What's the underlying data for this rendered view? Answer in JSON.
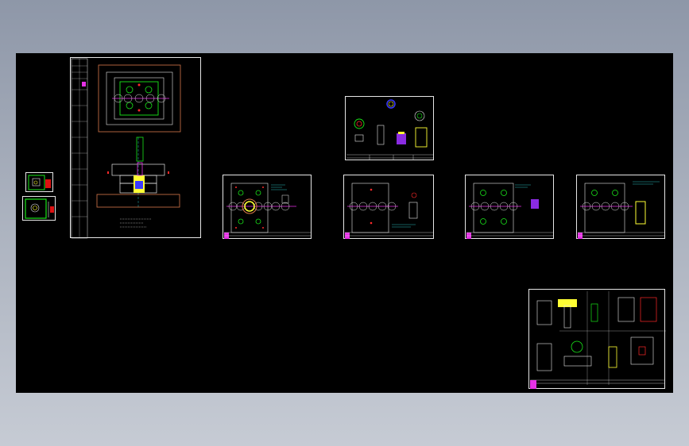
{
  "viewer": {
    "background_top": "#8e97a8",
    "background_bottom": "#c6cbd4",
    "canvas_color": "#000000"
  },
  "colors": {
    "frame": "#e6e6e6",
    "green": "#19e619",
    "red": "#ff2a2a",
    "yellow": "#ffff33",
    "magenta": "#e632e6",
    "blue": "#3a3aff",
    "orange": "#d9774a",
    "cyan": "#33e6e6"
  },
  "drawings": [
    {
      "id": "mini-a",
      "kind": "thumbnail"
    },
    {
      "id": "mini-b",
      "kind": "thumbnail"
    },
    {
      "id": "assembly",
      "kind": "mold-assembly",
      "note_lines": 3
    },
    {
      "id": "parts-top",
      "kind": "part-sheet"
    },
    {
      "id": "plate-1",
      "kind": "plate-sheet"
    },
    {
      "id": "plate-2",
      "kind": "plate-sheet"
    },
    {
      "id": "plate-3",
      "kind": "plate-sheet"
    },
    {
      "id": "plate-4",
      "kind": "plate-sheet"
    },
    {
      "id": "parts-detail",
      "kind": "detail-sheet"
    }
  ]
}
